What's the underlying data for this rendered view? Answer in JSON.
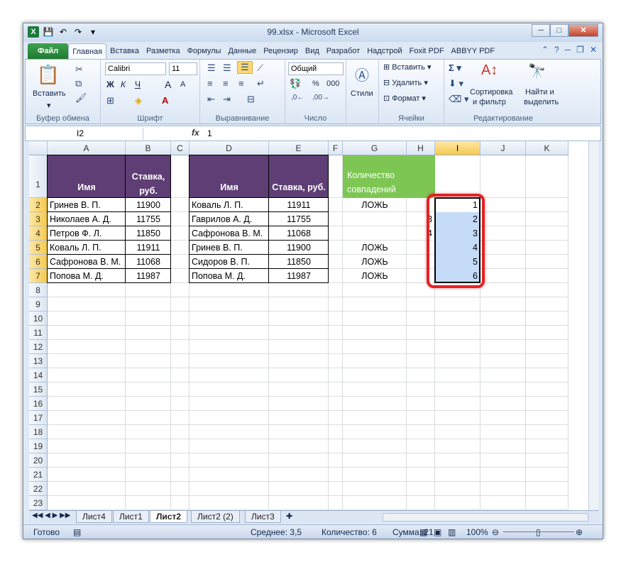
{
  "window": {
    "title": "99.xlsx - Microsoft Excel",
    "min": "─",
    "max": "□",
    "close": "✕"
  },
  "qat": {
    "excel": "X",
    "save": "💾",
    "undo": "↶",
    "redo": "↷",
    "extra": "▾"
  },
  "tabs": [
    "Файл",
    "Главная",
    "Вставка",
    "Разметка",
    "Формулы",
    "Данные",
    "Рецензир",
    "Вид",
    "Разработ",
    "Надстрой",
    "Foxit PDF",
    "ABBYY PDF"
  ],
  "ribbon": {
    "clipboard": {
      "paste": "Вставить",
      "label": "Буфер обмена"
    },
    "font": {
      "name": "Calibri",
      "size": "11",
      "bold": "Ж",
      "italic": "К",
      "underline": "Ч",
      "grow": "A",
      "shrink": "A",
      "label": "Шрифт"
    },
    "align": {
      "label": "Выравнивание"
    },
    "number": {
      "format": "Общий",
      "percent": "%",
      "thousands": "000",
      "label": "Число"
    },
    "styles": {
      "label": "Стили"
    },
    "cells": {
      "insert": "Вставить",
      "delete": "Удалить",
      "format": "Формат",
      "label": "Ячейки"
    },
    "editing": {
      "sort": "Сортировка",
      "sort2": "и фильтр",
      "find": "Найти и",
      "find2": "выделить",
      "label": "Редактирование"
    }
  },
  "formula_bar": {
    "name_box": "I2",
    "fx": "fx",
    "value": "1"
  },
  "columns": [
    "A",
    "B",
    "C",
    "D",
    "E",
    "F",
    "G",
    "H",
    "I",
    "J",
    "K"
  ],
  "rows": [
    "1",
    "2",
    "3",
    "4",
    "5",
    "6",
    "7",
    "8",
    "9",
    "10",
    "11",
    "12",
    "13",
    "14",
    "15",
    "16",
    "17",
    "18",
    "19",
    "20",
    "21",
    "22",
    "23"
  ],
  "table1": {
    "h_name": "Имя",
    "h_rate": "Ставка, руб.",
    "rows": [
      [
        "Гринев В. П.",
        "11900"
      ],
      [
        "Николаев А. Д.",
        "11755"
      ],
      [
        "Петров Ф. Л.",
        "11850"
      ],
      [
        "Коваль Л. П.",
        "11911"
      ],
      [
        "Сафронова В. М.",
        "11068"
      ],
      [
        "Попова М. Д.",
        "11987"
      ]
    ]
  },
  "table2": {
    "h_name": "Имя",
    "h_rate": "Ставка, руб.",
    "rows": [
      [
        "Коваль Л. П.",
        "11911"
      ],
      [
        "Гаврилов А. Д.",
        "11755"
      ],
      [
        "Сафронова В. М.",
        "11068"
      ],
      [
        "Гринев В. П.",
        "11900"
      ],
      [
        "Сидоров В. П.",
        "11850"
      ],
      [
        "Попова М. Д.",
        "11987"
      ]
    ]
  },
  "g_header": "Количество совпадений",
  "g_values": [
    "ЛОЖЬ",
    "3",
    "4",
    "ЛОЖЬ",
    "ЛОЖЬ",
    "ЛОЖЬ"
  ],
  "i_values": [
    "1",
    "2",
    "3",
    "4",
    "5",
    "6"
  ],
  "sheets": [
    "Лист4",
    "Лист1",
    "Лист2",
    "Лист2 (2)",
    "Лист3"
  ],
  "status": {
    "ready": "Готово",
    "avg": "Среднее: 3,5",
    "count": "Количество: 6",
    "sum": "Сумма: 21",
    "zoom": "100%"
  },
  "colors": {
    "header_fill": "#5e3e74",
    "g_header_fill": "#7dc653",
    "selection": "#c5dbf7",
    "red": "#e42124"
  }
}
